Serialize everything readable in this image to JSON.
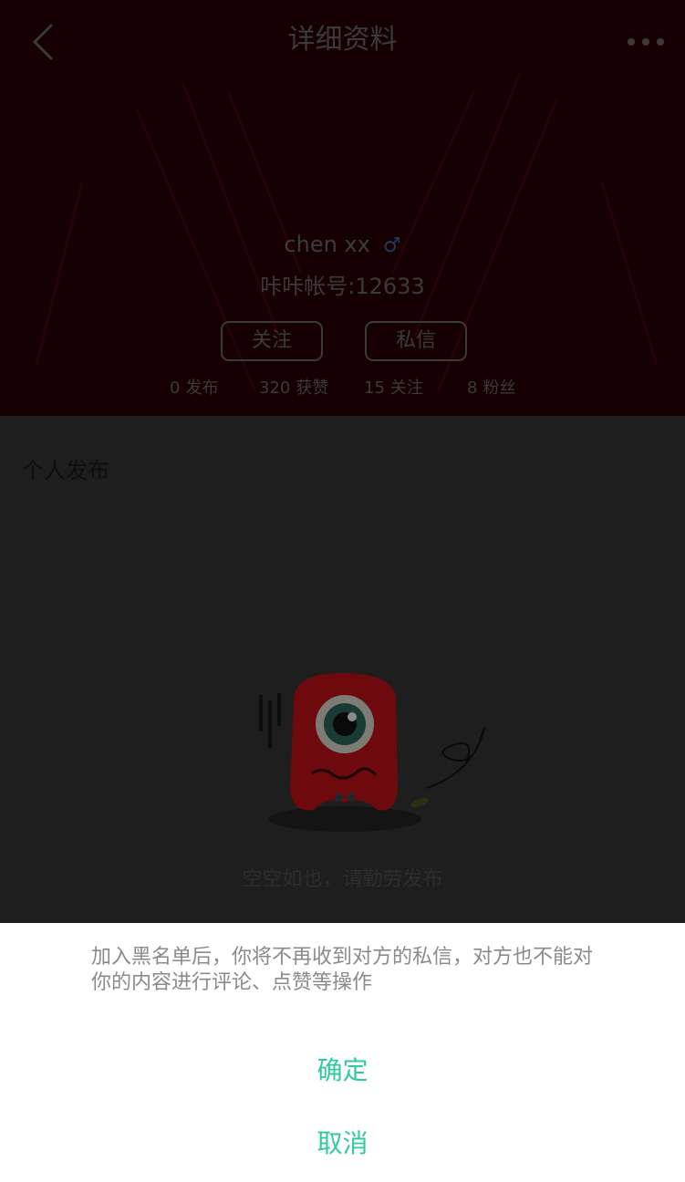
{
  "nav": {
    "title": "详细资料"
  },
  "profile": {
    "username": "chen xx",
    "gender_symbol": "♂",
    "account_label": "咔咔帐号:12633",
    "follow_button": "关注",
    "message_button": "私信"
  },
  "stats": [
    {
      "value": "0",
      "label": "发布"
    },
    {
      "value": "320",
      "label": "获赞"
    },
    {
      "value": "15",
      "label": "关注"
    },
    {
      "value": "8",
      "label": "粉丝"
    }
  ],
  "section": {
    "title": "个人发布",
    "empty_text": "空空如也，请勤劳发布"
  },
  "dialog": {
    "message": "加入黑名单后，你将不再收到对方的私信，对方也不能对你的内容进行评论、点赞等操作",
    "confirm": "确定",
    "cancel": "取消"
  },
  "colors": {
    "accent": "#2fc9a2",
    "header_bg": "#170004",
    "overlay_bg": "#1e1e1e",
    "mascot": "#6e0a0e"
  }
}
